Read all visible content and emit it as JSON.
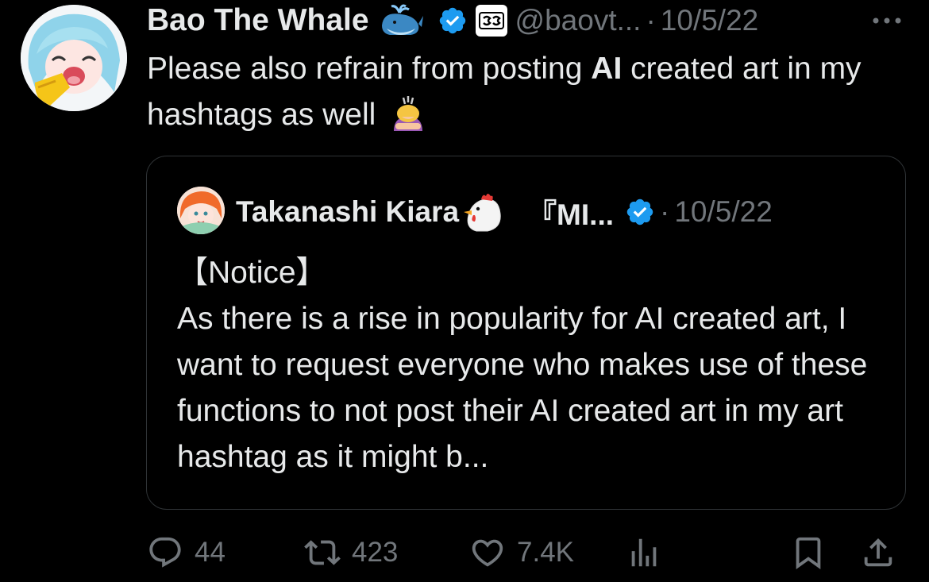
{
  "tweet": {
    "author_name": "Bao The Whale",
    "handle": "@baovt...",
    "separator": "·",
    "date": "10/5/22",
    "text_before_bold": "Please also refrain from posting ",
    "text_bold": "AI",
    "text_after_bold": " created art in my hashtags as well",
    "author_emoji": "whale-emoji",
    "trailing_emoji": "person-bowing-emoji"
  },
  "quote": {
    "author_name": "Takanashi Kiara",
    "author_suffix": "『MI...",
    "separator": "·",
    "date": "10/5/22",
    "line1": "【Notice】",
    "body": "As there is a rise in popularity for AI created art, I want to request everyone who makes use of these functions to not post their AI created art in my art hashtag as it might b...",
    "author_emoji": "chicken-emoji"
  },
  "actions": {
    "replies": "44",
    "retweets": "423",
    "likes": "7.4K"
  },
  "colors": {
    "background": "#000000",
    "text": "#e7e9ea",
    "muted": "#71767b",
    "verified_blue": "#1d9bf0",
    "border": "#2f3336"
  }
}
